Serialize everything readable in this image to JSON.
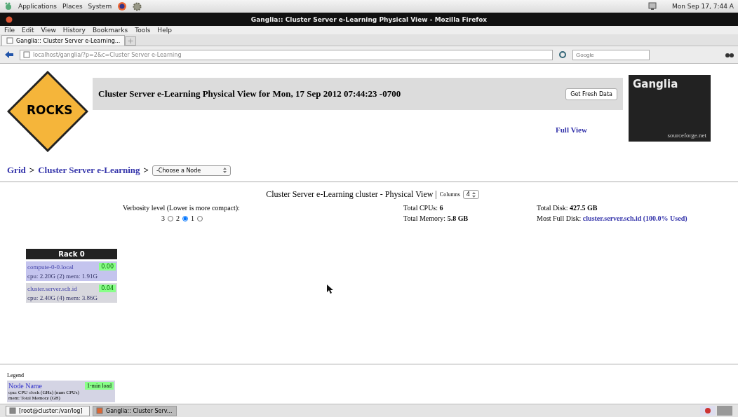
{
  "desktop_panel": {
    "menus": [
      "Applications",
      "Places",
      "System"
    ],
    "clock": "Mon Sep 17,  7:44 A"
  },
  "window": {
    "title": "Ganglia:: Cluster Server e-Learning Physical View - Mozilla Firefox"
  },
  "menu": [
    "File",
    "Edit",
    "View",
    "History",
    "Bookmarks",
    "Tools",
    "Help"
  ],
  "tabs": [
    {
      "label": "Ganglia:: Cluster Server e-Learning...",
      "selected": true
    }
  ],
  "address": {
    "value": "localhost/ganglia/?p=2&c=Cluster Server e-Learning"
  },
  "search": {
    "placeholder": "Google"
  },
  "header": {
    "logo": "ROCKS",
    "title": "Cluster Server e-Learning Physical View for Mon, 17 Sep 2012 07:44:23 -0700",
    "button": "Get Fresh Data",
    "full_view": "Full View",
    "brand": "Ganglia",
    "brand_sub": "sourceforge.net"
  },
  "breadcrumb": {
    "items": [
      "Grid",
      "Cluster Server e-Learning"
    ],
    "separator": ">",
    "node_select": "-Choose a Node"
  },
  "summary": {
    "title": "Cluster Server e-Learning cluster - Physical View |",
    "columns_label": "Columns",
    "columns_value": "4",
    "verbosity_label": "Verbosity level (Lower is more compact):",
    "verbosity": [
      {
        "label": "3",
        "selected": false
      },
      {
        "label": "2",
        "selected": true
      },
      {
        "label": "1",
        "selected": false
      }
    ],
    "cpus_label": "Total CPUs:",
    "cpus": "6",
    "memory_label": "Total Memory:",
    "memory": "5.8 GB",
    "disk_label": "Total Disk:",
    "disk": "427.5 GB",
    "full_disk_label": "Most Full Disk:",
    "full_disk": "cluster.server.sch.id (100.0% Used)"
  },
  "rack": {
    "title": "Rack 0",
    "nodes": [
      {
        "name": "compute-0-0.local",
        "load": "0.00",
        "info": "cpu: 2.20G (2) mem: 1.91G",
        "color": "#c4c4ee"
      },
      {
        "name": "cluster.server.sch.id",
        "load": "0.04",
        "info": "cpu: 2.40G (4) mem: 3.86G",
        "color": "#d8d8de"
      }
    ]
  },
  "legend": {
    "title": "Legend",
    "node_name": "Node Name",
    "load": "1-min load",
    "lines": [
      "cpu: CPU clock (GHz) (num CPUs)",
      "mem: Total Memory (GB)"
    ]
  },
  "taskbar": [
    {
      "label": "[root@cluster:/var/log]",
      "selected": false
    },
    {
      "label": "Ganglia:: Cluster Serv...",
      "selected": true
    }
  ]
}
